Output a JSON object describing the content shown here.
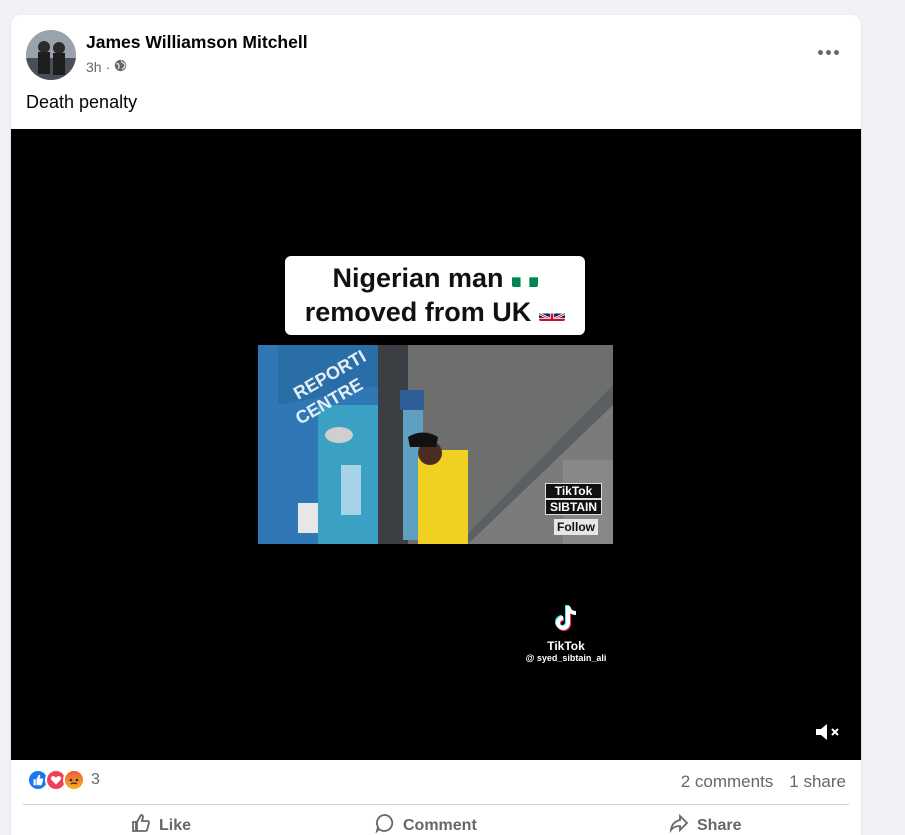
{
  "post": {
    "author": "James Williamson Mitchell",
    "time": "3h",
    "separator": "·",
    "privacy_icon": "globe-icon",
    "text": "Death penalty",
    "more_icon": "more-horizontal-icon"
  },
  "video": {
    "caption_line1": "Nigerian man",
    "caption_line2": "removed from UK",
    "clip_tiktok_label": "TikTok",
    "clip_tiktok_user": "SIBTAIN",
    "clip_follow": "Follow",
    "watermark_name": "TikTok",
    "watermark_handle": "@ syed_sibtain_ali",
    "mute_icon": "volume-muted-icon"
  },
  "reactions": {
    "icons": [
      "like-reaction-icon",
      "love-reaction-icon",
      "angry-reaction-icon"
    ],
    "count": "3",
    "comments": "2 comments",
    "shares": "1 share"
  },
  "actions": {
    "like": "Like",
    "comment": "Comment",
    "share": "Share"
  },
  "colors": {
    "facebook_blue": "#1877f2",
    "love_red": "#f33e58",
    "angry_orange": "#f7b125",
    "muted_text": "#65676b"
  }
}
